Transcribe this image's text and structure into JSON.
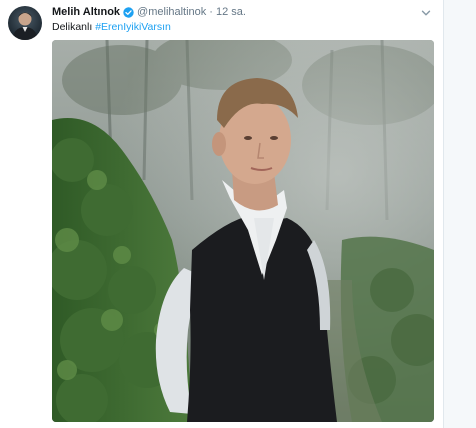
{
  "tweet": {
    "display_name": "Melih Altınok",
    "handle": "@melihaltinok",
    "separator": "·",
    "timestamp": "12 sa.",
    "text_prefix": "Delikanlı ",
    "hashtag": "#ErenIyikiVarsın"
  },
  "colors": {
    "name": "#14171a",
    "meta": "#657786",
    "link": "#1da1f2",
    "verified": "#1da1f2"
  },
  "icons": {
    "verified": "verified-badge-icon",
    "more": "chevron-down-icon"
  }
}
